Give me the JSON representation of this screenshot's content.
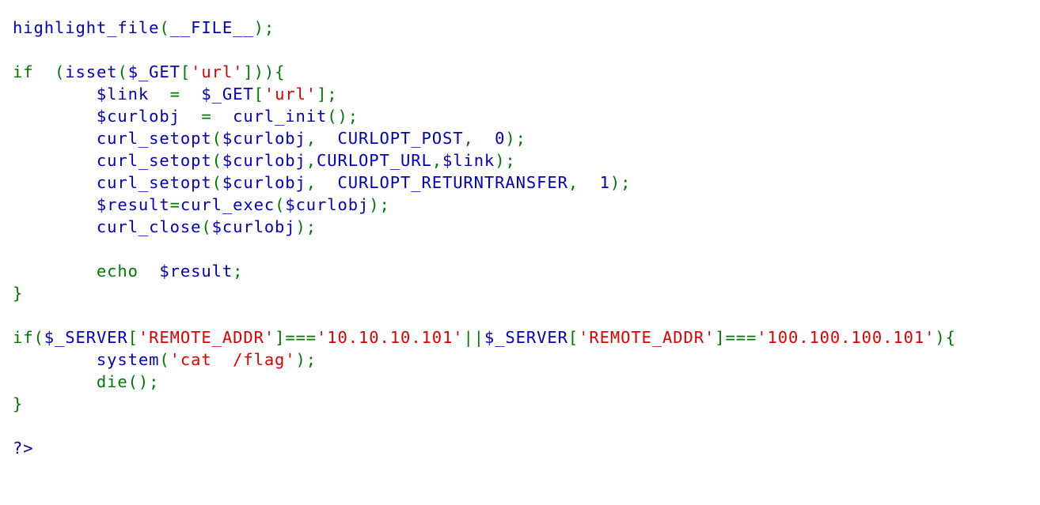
{
  "colors": {
    "default": "#0000BB",
    "keyword": "#007700",
    "string": "#DD0000",
    "html": "#000000"
  },
  "source_lines": [
    [
      [
        "default",
        "highlight_file"
      ],
      [
        "keyword",
        "("
      ],
      [
        "default",
        "__FILE__"
      ],
      [
        "keyword",
        ");"
      ]
    ],
    [],
    [
      [
        "keyword",
        "if  ("
      ],
      [
        "default",
        "isset"
      ],
      [
        "keyword",
        "("
      ],
      [
        "default",
        "$_GET"
      ],
      [
        "keyword",
        "["
      ],
      [
        "string",
        "'url'"
      ],
      [
        "keyword",
        "])){"
      ]
    ],
    [
      [
        "default",
        "        $link  "
      ],
      [
        "keyword",
        "=  "
      ],
      [
        "default",
        "$_GET"
      ],
      [
        "keyword",
        "["
      ],
      [
        "string",
        "'url'"
      ],
      [
        "keyword",
        "];"
      ]
    ],
    [
      [
        "default",
        "        $curlobj  "
      ],
      [
        "keyword",
        "=  "
      ],
      [
        "default",
        "curl_init"
      ],
      [
        "keyword",
        "();"
      ]
    ],
    [
      [
        "default",
        "        curl_setopt"
      ],
      [
        "keyword",
        "("
      ],
      [
        "default",
        "$curlobj"
      ],
      [
        "keyword",
        ",  "
      ],
      [
        "default",
        "CURLOPT_POST"
      ],
      [
        "keyword",
        ",  "
      ],
      [
        "default",
        "0"
      ],
      [
        "keyword",
        ");"
      ]
    ],
    [
      [
        "default",
        "        curl_setopt"
      ],
      [
        "keyword",
        "("
      ],
      [
        "default",
        "$curlobj"
      ],
      [
        "keyword",
        ","
      ],
      [
        "default",
        "CURLOPT_URL"
      ],
      [
        "keyword",
        ","
      ],
      [
        "default",
        "$link"
      ],
      [
        "keyword",
        ");"
      ]
    ],
    [
      [
        "default",
        "        curl_setopt"
      ],
      [
        "keyword",
        "("
      ],
      [
        "default",
        "$curlobj"
      ],
      [
        "keyword",
        ",  "
      ],
      [
        "default",
        "CURLOPT_RETURNTRANSFER"
      ],
      [
        "keyword",
        ",  "
      ],
      [
        "default",
        "1"
      ],
      [
        "keyword",
        ");"
      ]
    ],
    [
      [
        "default",
        "        $result"
      ],
      [
        "keyword",
        "="
      ],
      [
        "default",
        "curl_exec"
      ],
      [
        "keyword",
        "("
      ],
      [
        "default",
        "$curlobj"
      ],
      [
        "keyword",
        ");"
      ]
    ],
    [
      [
        "default",
        "        curl_close"
      ],
      [
        "keyword",
        "("
      ],
      [
        "default",
        "$curlobj"
      ],
      [
        "keyword",
        ");"
      ]
    ],
    [],
    [
      [
        "keyword",
        "        echo  "
      ],
      [
        "default",
        "$result"
      ],
      [
        "keyword",
        ";"
      ]
    ],
    [
      [
        "keyword",
        "}"
      ]
    ],
    [],
    [
      [
        "keyword",
        "if("
      ],
      [
        "default",
        "$_SERVER"
      ],
      [
        "keyword",
        "["
      ],
      [
        "string",
        "'REMOTE_ADDR'"
      ],
      [
        "keyword",
        "]==="
      ],
      [
        "string",
        "'10.10.10.101'"
      ],
      [
        "keyword",
        "||"
      ],
      [
        "default",
        "$_SERVER"
      ],
      [
        "keyword",
        "["
      ],
      [
        "string",
        "'REMOTE_ADDR'"
      ],
      [
        "keyword",
        "]==="
      ],
      [
        "string",
        "'100.100.100.101'"
      ],
      [
        "keyword",
        "){"
      ]
    ],
    [
      [
        "default",
        "        system"
      ],
      [
        "keyword",
        "("
      ],
      [
        "string",
        "'cat  /flag'"
      ],
      [
        "keyword",
        ");"
      ]
    ],
    [
      [
        "keyword",
        "        die"
      ],
      [
        "keyword",
        "();"
      ]
    ],
    [
      [
        "keyword",
        "}"
      ]
    ],
    [],
    [
      [
        "default",
        "?>"
      ]
    ]
  ]
}
